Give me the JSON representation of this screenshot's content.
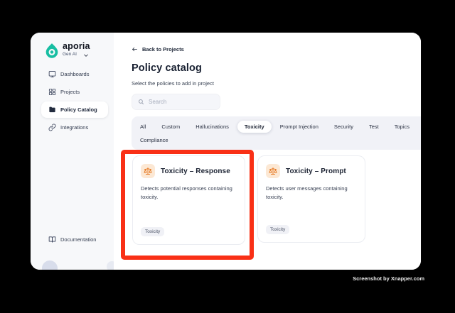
{
  "app": {
    "brand": "aporia",
    "workspace": "Gen AI"
  },
  "sidebar": {
    "items": [
      {
        "label": "Dashboards",
        "icon": "dashboards-icon",
        "active": false
      },
      {
        "label": "Projects",
        "icon": "projects-icon",
        "active": false
      },
      {
        "label": "Policy Catalog",
        "icon": "folder-icon",
        "active": true
      },
      {
        "label": "Integrations",
        "icon": "link-icon",
        "active": false
      }
    ],
    "footer": {
      "label": "Documentation",
      "icon": "book-icon"
    }
  },
  "main": {
    "back_label": "Back to Projects",
    "title": "Policy catalog",
    "subtitle": "Select the policies to add in project",
    "search": {
      "placeholder": "Search"
    },
    "tabs": {
      "row1": [
        "All",
        "Custom",
        "Hallucinations",
        "Toxicity",
        "Prompt Injection",
        "Security",
        "Test",
        "Topics"
      ],
      "row2": [
        "Compliance"
      ],
      "active": "Toxicity"
    },
    "cards": [
      {
        "title": "Toxicity – Response",
        "description": "Detects potential responses containing toxicity.",
        "tag": "Toxicity",
        "icon": "scales-icon",
        "highlighted": true
      },
      {
        "title": "Toxicity – Prompt",
        "description": "Detects user messages containing toxicity.",
        "tag": "Toxicity",
        "icon": "scales-icon",
        "highlighted": false
      }
    ]
  },
  "annotation": {
    "type": "highlight-rectangle",
    "color": "#F93016"
  },
  "watermark": "Screenshot by Xnapper.com",
  "colors": {
    "brand_teal": "#17BEA2",
    "icon_orange": "#E87E2B",
    "icon_chip_bg": "#FCE8D4",
    "annotation_red": "#F93016",
    "sidebar_bg": "#F7F8FA",
    "tabs_bg": "#F1F2F7"
  }
}
